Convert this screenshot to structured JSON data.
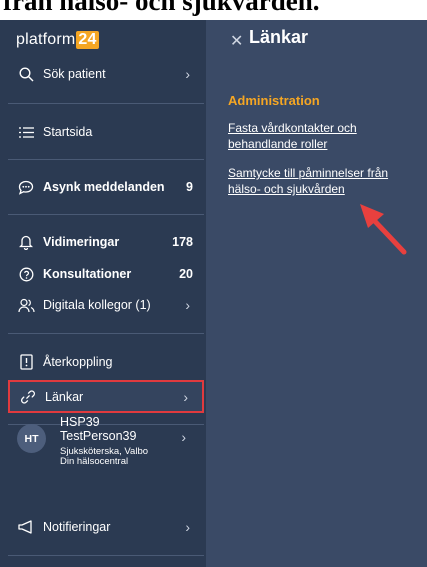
{
  "heading": "från hälso- och sjukvården.",
  "logo": {
    "text": "platform",
    "badge": "24",
    "badge_color": "#f5a623"
  },
  "nav": [
    {
      "label": "Sök patient",
      "icon": "search-icon",
      "count": "",
      "chevron": true,
      "bold": false
    },
    {
      "label": "Startsida",
      "icon": "list-icon",
      "count": "",
      "chevron": false,
      "bold": false
    },
    {
      "label": "Asynk meddelanden",
      "icon": "chat-icon",
      "count": "9",
      "chevron": false,
      "bold": true
    },
    {
      "label": "Vidimeringar",
      "icon": "bell-icon",
      "count": "178",
      "chevron": false,
      "bold": true
    },
    {
      "label": "Konsultationer",
      "icon": "help-circle-icon",
      "count": "20",
      "chevron": false,
      "bold": true
    },
    {
      "label": "Digitala kollegor (1)",
      "icon": "users-icon",
      "count": "",
      "chevron": true,
      "bold": false
    },
    {
      "label": "Återkoppling",
      "icon": "feedback-icon",
      "count": "",
      "chevron": false,
      "bold": false
    },
    {
      "label": "Länkar",
      "icon": "link-icon",
      "count": "",
      "chevron": true,
      "bold": false,
      "active": true
    },
    {
      "label": "Notifieringar",
      "icon": "megaphone-icon",
      "count": "",
      "chevron": true,
      "bold": false
    }
  ],
  "user": {
    "initials": "HT",
    "id": "HSP39",
    "name": "TestPerson39",
    "role": "Sjuksköterska, Valbo",
    "unit": "Din hälsocentral"
  },
  "panel": {
    "title": "Länkar",
    "section": "Administration",
    "links": [
      "Fasta vårdkontakter och behandlande roller",
      "Samtycke till påminnelser från hälso- och sjukvården"
    ]
  },
  "colors": {
    "sidebar": "#2b3a52",
    "panel": "#3a4a66",
    "accent": "#f5a623",
    "highlight": "#e03a3e"
  }
}
